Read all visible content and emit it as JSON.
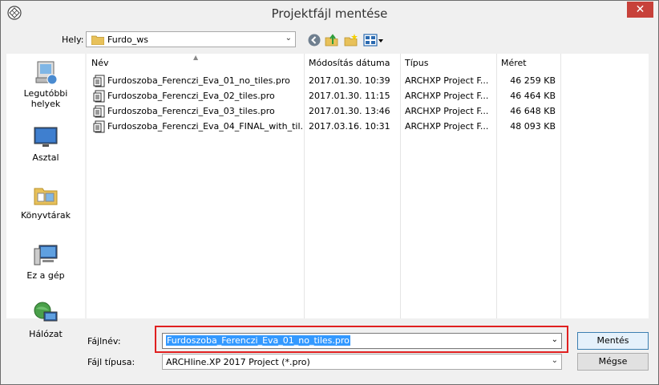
{
  "window": {
    "title": "Projektfájl mentése",
    "close_glyph": "✕"
  },
  "location": {
    "label": "Hely:",
    "value": "Furdo_ws"
  },
  "places": [
    {
      "label_line1": "Legutóbbi",
      "label_line2": "helyek",
      "icon": "recent-places-icon"
    },
    {
      "label_line1": "Asztal",
      "label_line2": "",
      "icon": "desktop-icon"
    },
    {
      "label_line1": "Könyvtárak",
      "label_line2": "",
      "icon": "libraries-icon"
    },
    {
      "label_line1": "Ez a gép",
      "label_line2": "",
      "icon": "computer-icon"
    },
    {
      "label_line1": "Hálózat",
      "label_line2": "",
      "icon": "network-icon"
    }
  ],
  "columns": {
    "name": "Név",
    "date": "Módosítás dátuma",
    "type": "Típus",
    "size": "Méret"
  },
  "files": [
    {
      "name": "Furdoszoba_Ferenczi_Eva_01_no_tiles.pro",
      "date": "2017.01.30. 10:39",
      "type": "ARCHXP Project F...",
      "size": "46 259 KB"
    },
    {
      "name": "Furdoszoba_Ferenczi_Eva_02_tiles.pro",
      "date": "2017.01.30. 11:15",
      "type": "ARCHXP Project F...",
      "size": "46 464 KB"
    },
    {
      "name": "Furdoszoba_Ferenczi_Eva_03_tiles.pro",
      "date": "2017.01.30. 13:46",
      "type": "ARCHXP Project F...",
      "size": "46 648 KB"
    },
    {
      "name": "Furdoszoba_Ferenczi_Eva_04_FINAL_with_til...",
      "date": "2017.03.16. 10:31",
      "type": "ARCHXP Project F...",
      "size": "48 093 KB"
    }
  ],
  "filename": {
    "label": "Fájlnév:",
    "value": "Furdoszoba_Ferenczi_Eva_01_no_tiles.pro"
  },
  "filetype": {
    "label": "Fájl típusa:",
    "value": "ARCHline.XP 2017 Project (*.pro)"
  },
  "buttons": {
    "save": "Mentés",
    "cancel": "Mégse"
  },
  "colors": {
    "accent": "#3399ff",
    "close": "#c7413a",
    "highlight": "#e02020"
  }
}
